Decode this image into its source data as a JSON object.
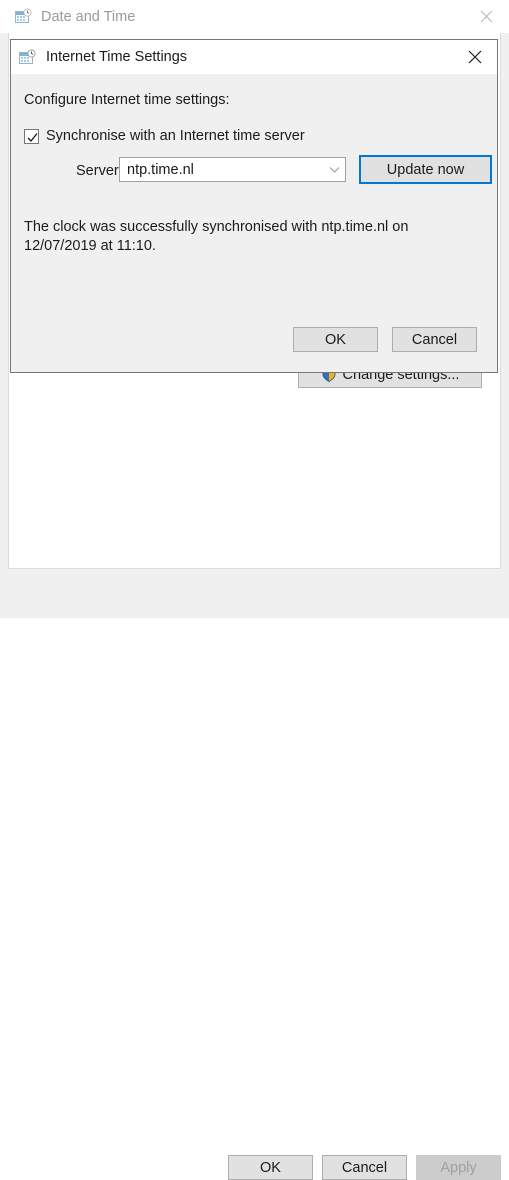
{
  "base_window": {
    "title": "Date and Time",
    "title_icon": "date-time-icon",
    "close_icon": "close-icon",
    "change_settings_label": "Change settings...",
    "change_settings_icon": "uac-shield-icon",
    "footer": {
      "ok_label": "OK",
      "cancel_label": "Cancel",
      "apply_label": "Apply",
      "apply_disabled": true
    },
    "colors": {
      "titlebar_bg": "#ffffff",
      "title_text_inactive": "#9a9a9a",
      "client_bg": "#ffffff",
      "chrome_bg": "#f0f0f0",
      "disabled_text": "#a0a0a0"
    }
  },
  "dialog": {
    "title": "Internet Time Settings",
    "title_icon": "date-time-icon",
    "close_icon": "close-icon",
    "heading": "Configure Internet time settings:",
    "sync_checkbox": {
      "label": "Synchronise with an Internet time server",
      "checked": true
    },
    "server": {
      "label": "Server:",
      "value": "ntp.time.nl",
      "arrow_icon": "chevron-down-icon",
      "options": [
        "ntp.time.nl"
      ]
    },
    "update_now_label": "Update now",
    "status_text": "The clock was successfully synchronised with ntp.time.nl on 12/07/2019 at 11:10.",
    "ok_label": "OK",
    "cancel_label": "Cancel",
    "colors": {
      "titlebar_bg": "#ffffff",
      "body_bg": "#f0f0f0",
      "border": "#767676",
      "focus_accent": "#0078d7",
      "button_bg": "#e1e1e1",
      "button_border": "#adadad",
      "text": "#1b1b1b"
    }
  }
}
